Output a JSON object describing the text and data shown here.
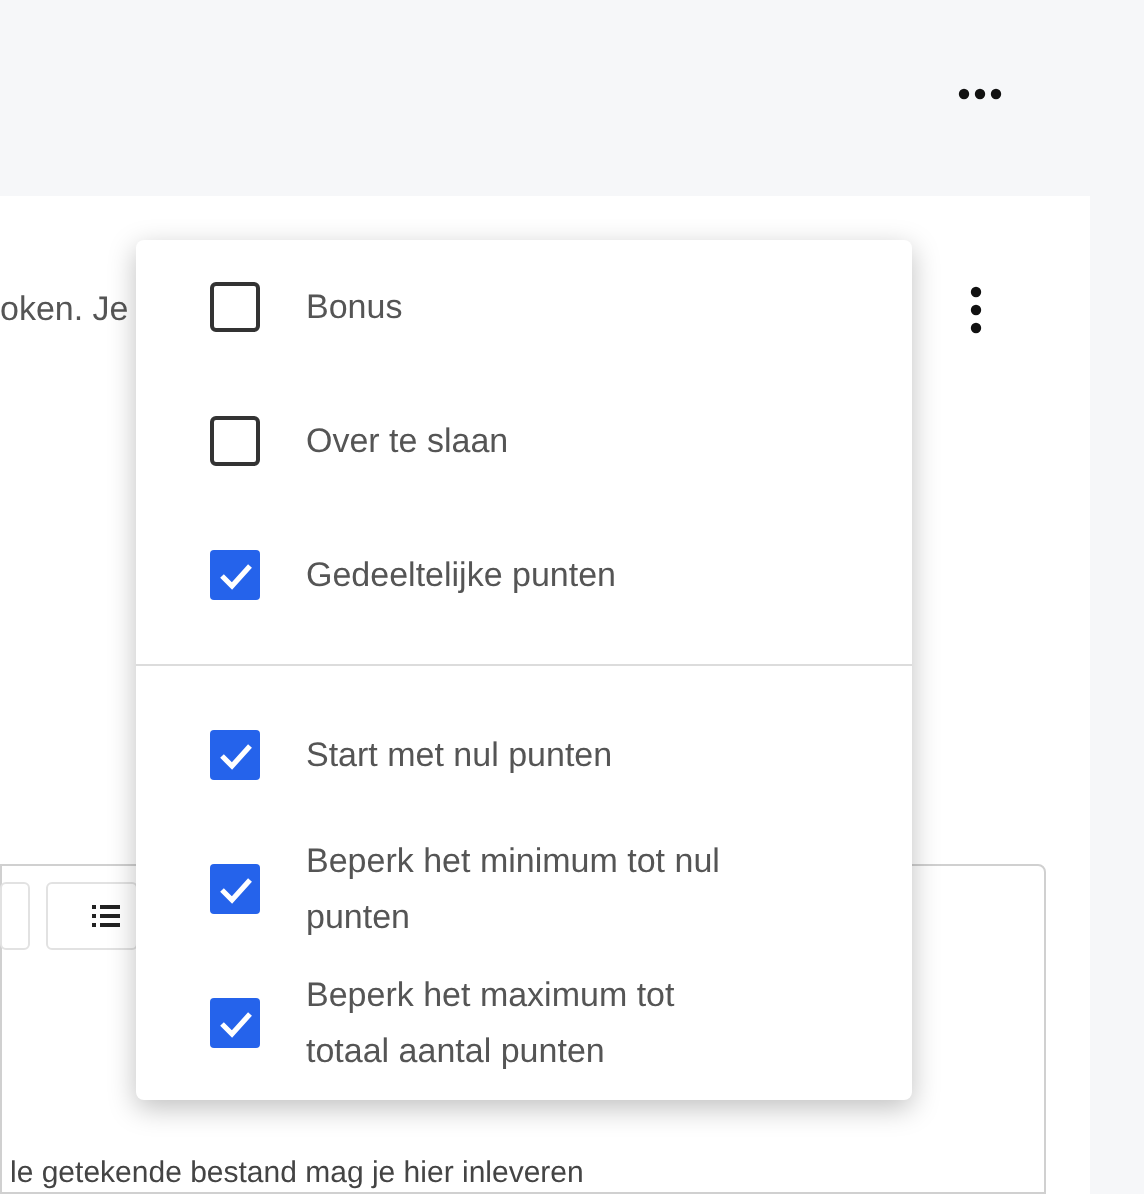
{
  "question_text": "oken. Je",
  "editor_text": "le getekende bestand mag je hier inleveren",
  "options_menu": {
    "groups": [
      {
        "items": [
          {
            "label": "Bonus",
            "checked": false
          },
          {
            "label": "Over te slaan",
            "checked": false
          },
          {
            "label": "Gedeeltelijke punten",
            "checked": true
          }
        ]
      },
      {
        "items": [
          {
            "label": "Start met nul punten",
            "checked": true
          },
          {
            "label": "Beperk het minimum tot nul punten",
            "checked": true
          },
          {
            "label": "Beperk het maximum tot totaal aantal punten",
            "checked": true
          }
        ]
      }
    ]
  }
}
